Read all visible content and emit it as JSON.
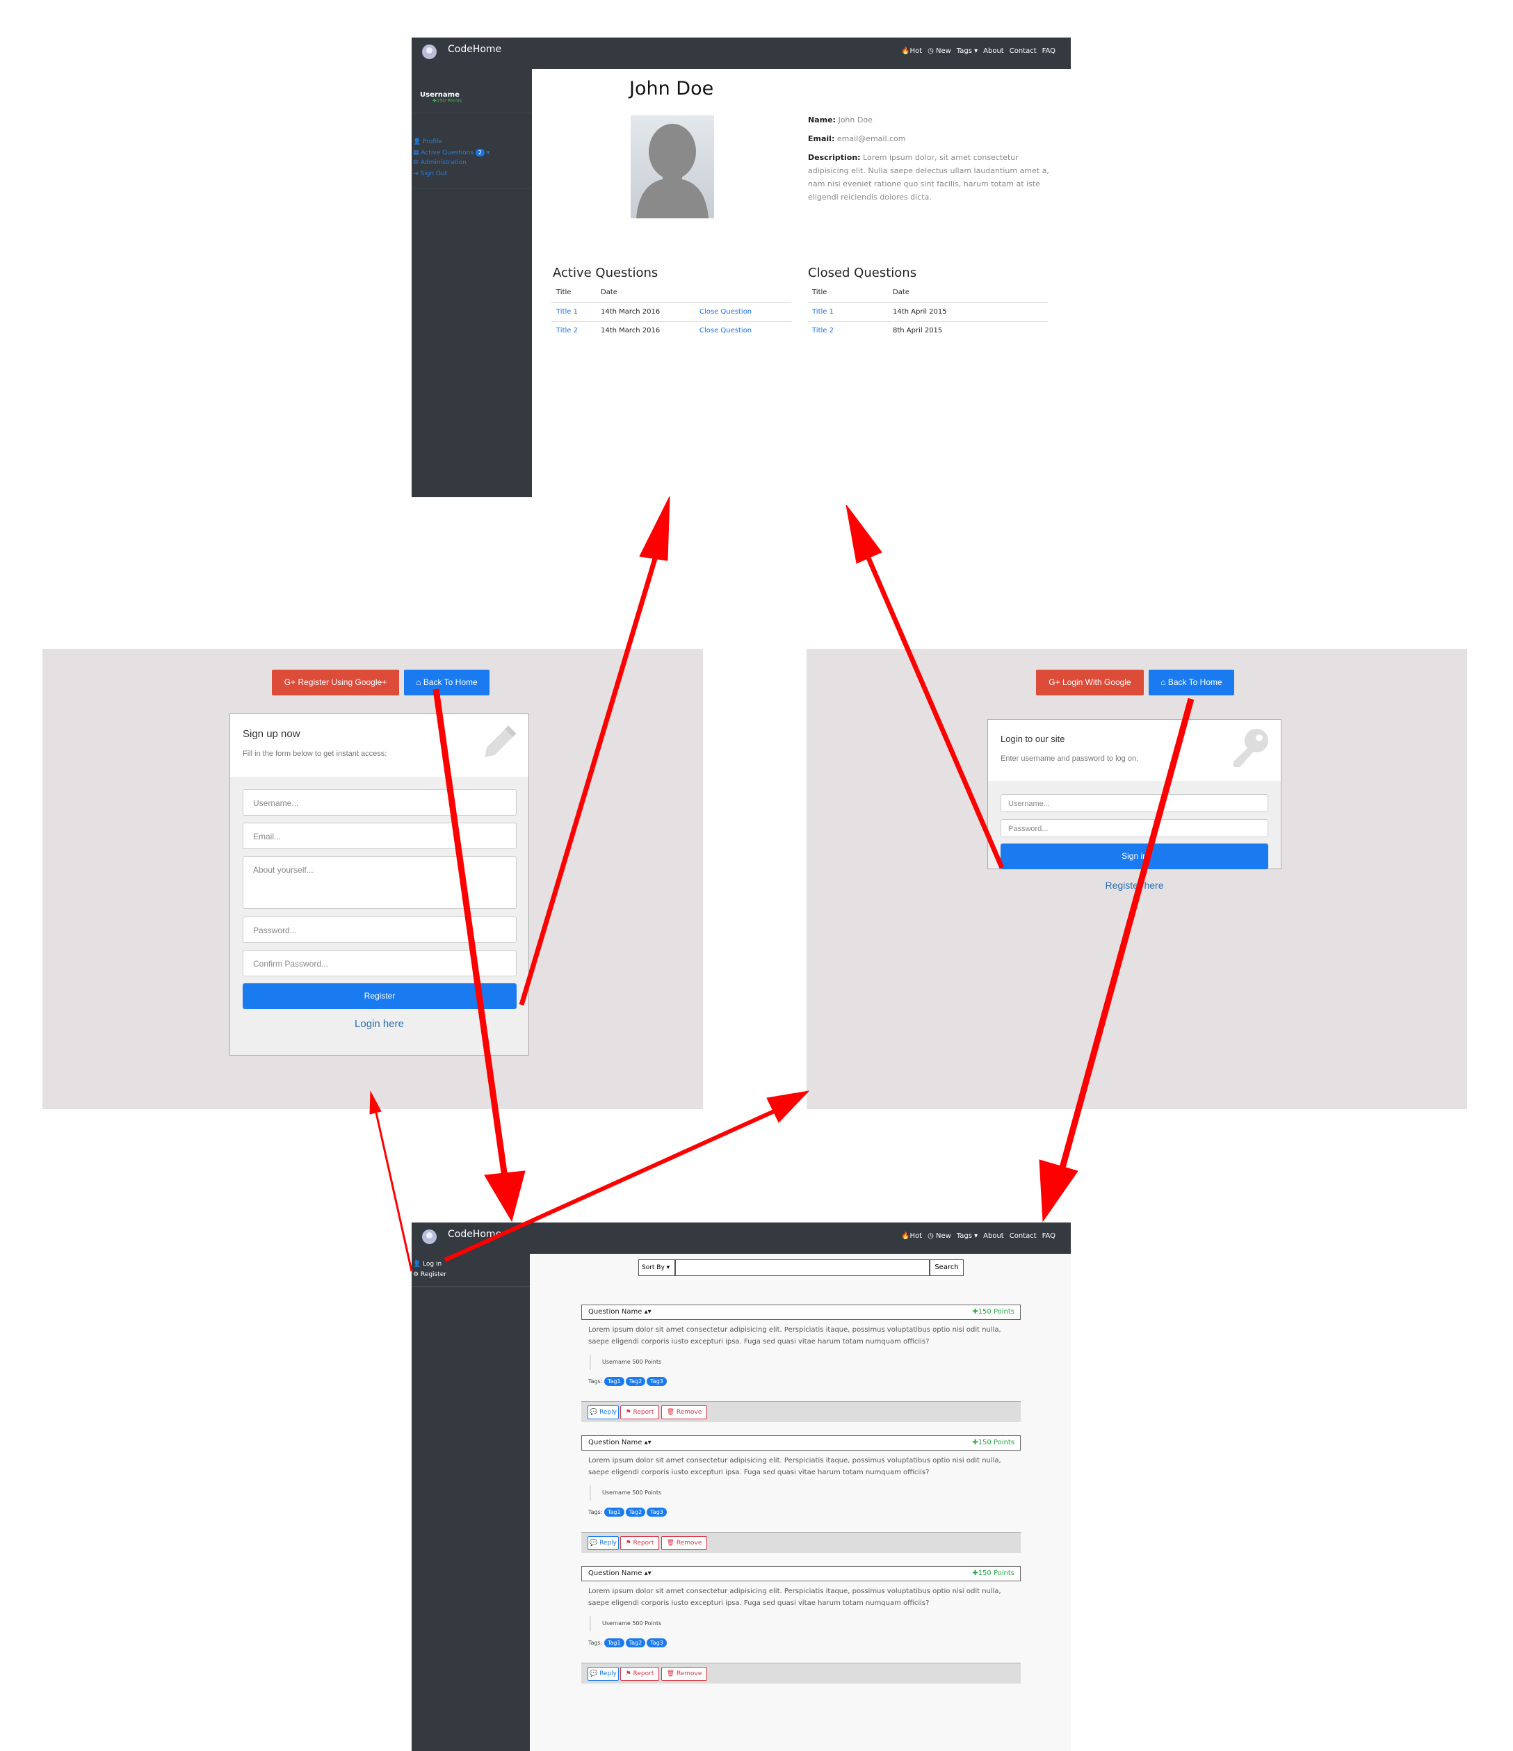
{
  "profile": {
    "navbar": {
      "brand": "CodeHome",
      "links": [
        "🔥Hot",
        "◷ New",
        "Tags ▾",
        "About",
        "Contact",
        "FAQ"
      ]
    },
    "sidebar": {
      "username": "Username",
      "points": "✚150 Points",
      "items": [
        "👤 Profile",
        "▦ Active Questions",
        "⚙ Administration",
        "⇥ Sign Out"
      ],
      "badge": "2"
    },
    "name": "John Doe",
    "details": {
      "name_label": "Name:",
      "name_value": "John Doe",
      "email_label": "Email:",
      "email_value": "email@email.com",
      "desc_label": "Description:",
      "desc_value": "Lorem ipsum dolor, sit amet consectetur adipisicing elit. Nulla saepe delectus ullam laudantium amet a, nam nisi eveniet ratione quo sint facilis, harum totam at iste eligendi reiciendis dolores dicta."
    },
    "active": {
      "title": "Active Questions",
      "headers": [
        "Title",
        "Date"
      ],
      "rows": [
        {
          "title": "Title 1",
          "date": "14th March 2016",
          "action": "Close Question"
        },
        {
          "title": "Title 2",
          "date": "14th March 2016",
          "action": "Close Question"
        }
      ]
    },
    "closed": {
      "title": "Closed Questions",
      "headers": [
        "Title",
        "Date"
      ],
      "rows": [
        {
          "title": "Title 1",
          "date": "14th April 2015"
        },
        {
          "title": "Title 2",
          "date": "8th April 2015"
        }
      ]
    }
  },
  "register": {
    "google_btn": "G+  Register Using Google+",
    "home_btn": "⌂ Back To Home",
    "card_title": "Sign up now",
    "card_sub": "Fill in the form below to get instant access:",
    "username_ph": "Username...",
    "email_ph": "Email...",
    "about_ph": "About yourself...",
    "password_ph": "Password...",
    "confirm_ph": "Confirm Password...",
    "submit": "Register",
    "login_link": "Login here"
  },
  "login": {
    "google_btn": "G+  Login With Google",
    "home_btn": "⌂ Back To Home",
    "card_title": "Login to our site",
    "card_sub": "Enter username and password to log on:",
    "username_ph": "Username...",
    "password_ph": "Password...",
    "submit": "Sign in",
    "register_link": "Register here"
  },
  "home": {
    "navbar": {
      "brand": "CodeHome",
      "links": [
        "🔥Hot",
        "◷ New",
        "Tags ▾",
        "About",
        "Contact",
        "FAQ"
      ]
    },
    "sidebar": {
      "items": [
        "👤 Log in",
        "⚙ Register"
      ]
    },
    "sort": "Sort By ▾",
    "search_btn": "Search",
    "questions": [
      {
        "name": "Question Name  ▴▾",
        "points": "✚150 Points",
        "text": "Lorem ipsum dolor sit amet consectetur adipisicing elit. Perspiciatis itaque, possimus voluptatibus optio nisi odit nulla, saepe eligendi corporis iusto excepturi ipsa. Fuga sed quasi vitae harum totam numquam officiis?",
        "user": "Username 500 Points",
        "tags_label": "Tags:",
        "tags": [
          "Tag1",
          "Tag2",
          "Tag3"
        ],
        "reply": "💬 Reply",
        "report": "⚑ Report",
        "remove": "🗑 Remove"
      },
      {
        "name": "Question Name  ▴▾",
        "points": "✚150 Points",
        "text": "Lorem ipsum dolor sit amet consectetur adipisicing elit. Perspiciatis itaque, possimus voluptatibus optio nisi odit nulla, saepe eligendi corporis iusto excepturi ipsa. Fuga sed quasi vitae harum totam numquam officiis?",
        "user": "Username 500 Points",
        "tags_label": "Tags:",
        "tags": [
          "Tag1",
          "Tag2",
          "Tag3"
        ],
        "reply": "💬 Reply",
        "report": "⚑ Report",
        "remove": "🗑 Remove"
      },
      {
        "name": "Question Name  ▴▾",
        "points": "✚150 Points",
        "text": "Lorem ipsum dolor sit amet consectetur adipisicing elit. Perspiciatis itaque, possimus voluptatibus optio nisi odit nulla, saepe eligendi corporis iusto excepturi ipsa. Fuga sed quasi vitae harum totam numquam officiis?",
        "user": "Username 500 Points",
        "tags_label": "Tags:",
        "tags": [
          "Tag1",
          "Tag2",
          "Tag3"
        ],
        "reply": "💬 Reply",
        "report": "⚑ Report",
        "remove": "🗑 Remove"
      }
    ]
  },
  "colors": {
    "arrow": "#ff0000",
    "navbar": "#343a40",
    "primary": "#1a7bf0",
    "google": "#dd4b39",
    "panel": "#e5e1e2"
  }
}
